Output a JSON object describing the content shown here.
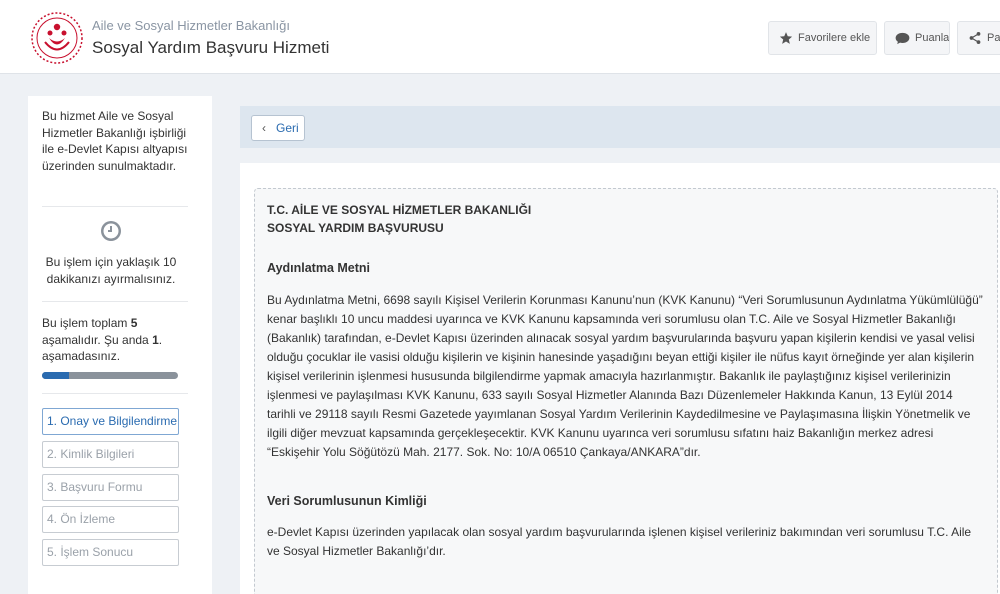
{
  "header": {
    "ministry": "Aile ve Sosyal Hizmetler Bakanlığı",
    "service_title": "Sosyal Yardım Başvuru Hizmeti",
    "buttons": {
      "favorite": "Favorilere ekle",
      "rate": "Puanla",
      "share": "Pa"
    }
  },
  "sidebar": {
    "intro": "Bu hizmet Aile ve Sosyal Hizmetler Bakanlığı işbirliği ile e-Devlet Kapısı altyapısı üzerinden sunulmaktadır.",
    "time_note": "Bu işlem için yaklaşık 10 dakikanızı ayırmalısınız.",
    "step_info": {
      "prefix": "Bu işlem toplam ",
      "total": "5",
      "middle": " aşamalıdır. Şu anda ",
      "current": "1",
      "suffix": ". aşamadasınız."
    },
    "progress_fraction": 0.2,
    "steps": [
      "1. Onay ve Bilgilendirme",
      "2. Kimlik Bilgileri",
      "3. Başvuru Formu",
      "4. Ön İzleme",
      "5. İşlem Sonucu"
    ]
  },
  "main": {
    "back_label": "Geri",
    "doc": {
      "heading_line1": "T.C. AİLE VE SOSYAL HİZMETLER BAKANLIĞI",
      "heading_line2": "SOSYAL YARDIM BAŞVURUSU",
      "section1_title": "Aydınlatma Metni",
      "section1_body": "Bu Aydınlatma Metni, 6698 sayılı Kişisel Verilerin Korunması Kanunu’nun (KVK Kanunu) “Veri Sorumlusunun Aydınlatma Yükümlülüğü” kenar başlıklı 10 uncu maddesi uyarınca ve KVK Kanunu kapsamında veri sorumlusu olan T.C. Aile ve Sosyal Hizmetler Bakanlığı (Bakanlık) tarafından, e-Devlet Kapısı üzerinden alınacak sosyal yardım başvurularında başvuru yapan kişilerin kendisi ve yasal velisi olduğu çocuklar ile vasisi olduğu kişilerin ve kişinin hanesinde yaşadığını beyan ettiği kişiler ile nüfus kayıt örneğinde yer alan kişilerin kişisel verilerinin işlenmesi hususunda bilgilendirme yapmak amacıyla hazırlanmıştır. Bakanlık ile paylaştığınız kişisel verilerinizin işlenmesi ve paylaşılması KVK Kanunu, 633 sayılı Sosyal Hizmetler Alanında Bazı Düzenlemeler Hakkında Kanun, 13 Eylül 2014 tarihli ve 29118 sayılı Resmi Gazetede yayımlanan Sosyal Yardım Verilerinin Kaydedilmesine ve Paylaşımasına İlişkin Yönetmelik ve ilgili diğer mevzuat kapsamında gerçekleşecektir. KVK Kanunu uyarınca veri sorumlusu sıfatını haiz Bakanlığın merkez adresi “Eskişehir Yolu Söğütözü Mah. 2177. Sok. No: 10/A 06510 Çankaya/ANKARA”dır.",
      "section2_title": "Veri Sorumlusunun Kimliği",
      "section2_body": "e-Devlet Kapısı üzerinden yapılacak olan sosyal yardım başvurularında işlenen kişisel verileriniz bakımından veri sorumlusu T.C. Aile ve Sosyal Hizmetler Bakanlığı’dır."
    }
  },
  "colors": {
    "brand_red": "#c8102e",
    "accent_blue": "#2a6bb0"
  }
}
